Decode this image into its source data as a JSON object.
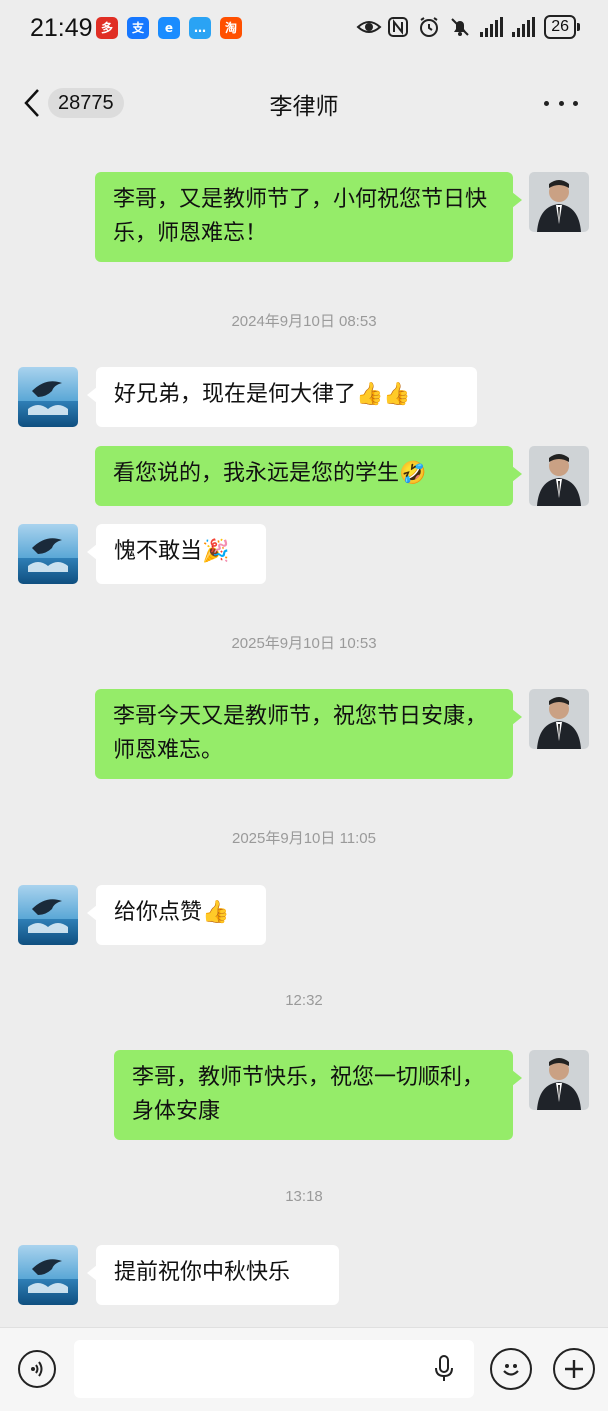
{
  "status_bar": {
    "time": "21:49",
    "apps": [
      {
        "name": "pinduoduo-icon",
        "glyph": "多",
        "color": "#e02e24"
      },
      {
        "name": "alipay-icon",
        "glyph": "支",
        "color": "#1677ff"
      },
      {
        "name": "browser-icon",
        "glyph": "e",
        "color": "#1a8cff"
      },
      {
        "name": "message-app-icon",
        "glyph": "…",
        "color": "#2aa3f4"
      },
      {
        "name": "taobao-icon",
        "glyph": "淘",
        "color": "#ff5000"
      }
    ],
    "battery": "26"
  },
  "header": {
    "back_count": "28775",
    "title": "李律师"
  },
  "messages": [
    {
      "side": "me",
      "text": "李哥，又是教师节了，小何祝您节日快乐，师恩难忘！"
    },
    {
      "timestamp": "2024年9月10日 08:53"
    },
    {
      "side": "them",
      "text": "好兄弟，现在是何大律了",
      "emoji": "👍👍"
    },
    {
      "side": "me",
      "text": "看您说的，我永远是您的学生",
      "emoji": "🤣"
    },
    {
      "side": "them",
      "text": "愧不敢当",
      "emoji": "🎉"
    },
    {
      "timestamp": "2025年9月10日 10:53"
    },
    {
      "side": "me",
      "text": "李哥今天又是教师节，祝您节日安康，师恩难忘。"
    },
    {
      "timestamp": "2025年9月10日 11:05"
    },
    {
      "side": "them",
      "text": "给你点赞",
      "emoji": "👍"
    },
    {
      "timestamp": "12:32"
    },
    {
      "side": "me",
      "text": "李哥，教师节快乐，祝您一切顺利，身体安康"
    },
    {
      "timestamp": "13:18"
    },
    {
      "side": "them",
      "text": "提前祝你中秋快乐"
    }
  ],
  "colors": {
    "my_bubble": "#95ec69",
    "their_bubble": "#ffffff",
    "background": "#ededed"
  }
}
